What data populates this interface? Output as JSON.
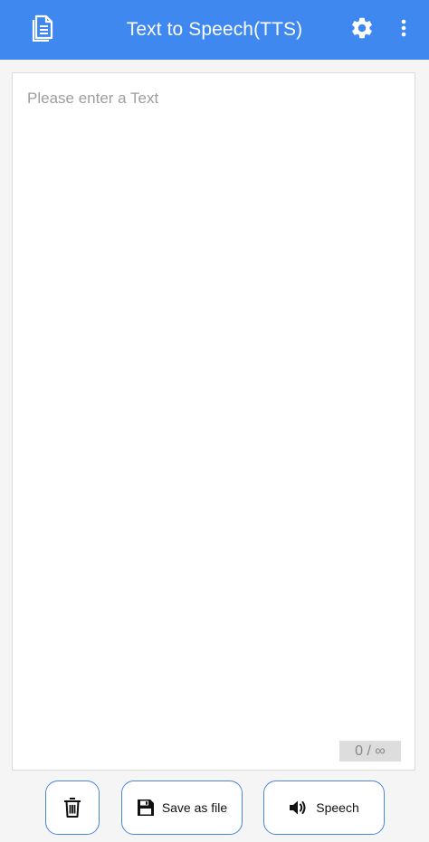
{
  "app_bar": {
    "title": "Text to Speech(TTS)",
    "left_icon": "document-icon",
    "settings_icon": "gear-icon",
    "more_icon": "more-vert-icon",
    "background_color": "#3f88f0"
  },
  "editor": {
    "placeholder": "Please enter a Text",
    "value": "",
    "counter": "0 / ∞"
  },
  "actions": {
    "delete_icon": "trash-icon",
    "save_label": "Save as file",
    "save_icon": "floppy-disk-icon",
    "speech_label": "Speech",
    "speech_icon": "speaker-icon",
    "border_color": "#4a86d8"
  }
}
